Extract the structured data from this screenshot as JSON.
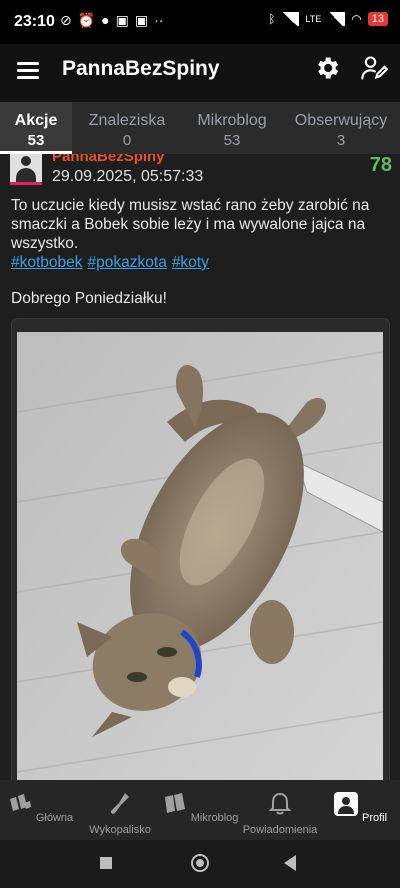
{
  "status_bar": {
    "time": "23:10",
    "network_label": "LTE",
    "battery": "13",
    "notification_icons": [
      "alarm-off-icon",
      "alarm-icon",
      "ball-icon",
      "app-icon",
      "app-icon",
      "more-icon"
    ]
  },
  "app_bar": {
    "title": "PannaBezSpiny",
    "icons": [
      "menu-icon",
      "gear-icon",
      "edit-profile-icon"
    ]
  },
  "tabs": [
    {
      "label": "Akcje",
      "count": "53",
      "active": true
    },
    {
      "label": "Znaleziska",
      "count": "0",
      "active": false
    },
    {
      "label": "Mikroblog",
      "count": "53",
      "active": false
    },
    {
      "label": "Obserwujący",
      "count": "3",
      "active": false
    }
  ],
  "post": {
    "author": "PannaBezSpiny",
    "score": "78",
    "date": "29.09.2025, 05:57:33",
    "text": "To uczucie kiedy musisz wstać rano żeby zarobić na smaczki a Bobek sobie leży i ma wywalone jajca na wszystko.",
    "tags": [
      "#kotbobek",
      "#pokazkota",
      "#koty"
    ],
    "greeting": "Dobrego Poniedziałku!"
  },
  "bottom_nav": [
    {
      "label": "Główna",
      "icon": "home-icon",
      "active": false
    },
    {
      "label": "Wykopalisko",
      "icon": "shovel-icon",
      "active": false
    },
    {
      "label": "Mikroblog",
      "icon": "mikroblog-icon",
      "active": false
    },
    {
      "label": "Powiadomienia",
      "icon": "bell-icon",
      "active": false
    },
    {
      "label": "Profil",
      "icon": "profile-icon",
      "active": true
    }
  ],
  "colors": {
    "author": "#e6502a",
    "score": "#5cbf5c",
    "tag": "#3aa0e8",
    "background": "#1e1e1e"
  }
}
